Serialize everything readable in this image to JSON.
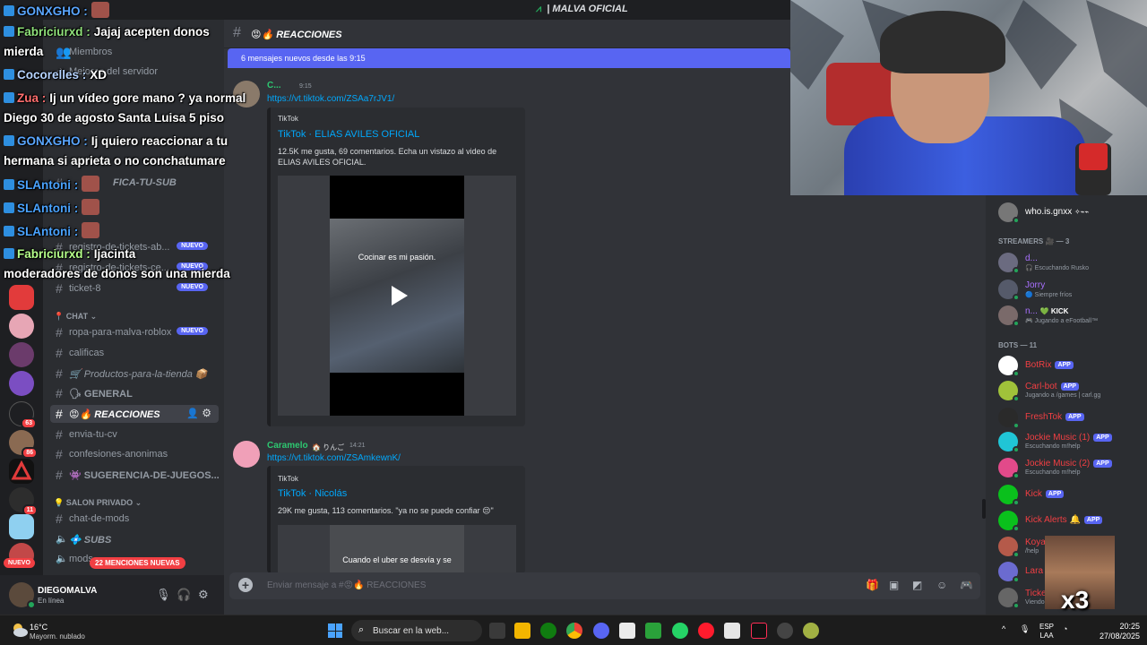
{
  "window": {
    "title": "| MALVA OFICIAL"
  },
  "sidebar": {
    "hidden_items": [
      "Miembros",
      "Mejoras del servidor"
    ],
    "partial_channel": "FICA-TU-SUB",
    "channels_tickets": [
      {
        "name": "registro-de-tickets-ab...",
        "badge": "NUEVO"
      },
      {
        "name": "registro-de-tickets-ce...",
        "badge": "NUEVO"
      },
      {
        "name": "ticket-8",
        "badge": "NUEVO"
      }
    ],
    "category_chat": "CHAT",
    "channels_chat": [
      {
        "name": "ropa-para-malva-roblox",
        "badge": "NUEVO"
      },
      {
        "name": "calificas",
        "badge": ""
      },
      {
        "name": "🛒 Productos-para-la-tienda 📦",
        "badge": ""
      },
      {
        "name": "🗣 GENERAL",
        "badge": ""
      },
      {
        "name": "😡🔥 REACCIONES",
        "badge": ""
      },
      {
        "name": "envia-tu-cv",
        "badge": ""
      },
      {
        "name": "confesiones-anonimas",
        "badge": ""
      },
      {
        "name": "👾 SUGERENCIA-DE-JUEGOS...",
        "badge": ""
      }
    ],
    "category_salon": "SALON PRIVADO",
    "channels_salon": [
      {
        "name": "chat-de-mods"
      },
      {
        "name": "💠 SUBS"
      },
      {
        "name": "mods"
      }
    ],
    "mentions_pill": "22 MENCIONES NUEVAS",
    "nuevo_pill": "NUEVO",
    "server_badges": [
      "63",
      "86",
      "11"
    ]
  },
  "user": {
    "name": "DIEGOMALVA",
    "status": "En línea"
  },
  "chat": {
    "channel_name": "😡🔥 REACCIONES",
    "new_messages_bar": "6 mensajes nuevos desde las 9:15",
    "messages": [
      {
        "author": "C...",
        "time": "9:15",
        "link": "https://vt.tiktok.com/ZSAa7rJV1/",
        "embed_provider": "TikTok",
        "embed_title": "TikTok · ELIAS AVILES OFICIAL",
        "embed_desc": "12.5K me gusta, 69 comentarios. Echa un vistazo al video de ELIAS AVILES OFICIAL.",
        "video_caption": "Cocinar es mi pasión."
      },
      {
        "author": "Caramelo",
        "author_tag": "🏠 りんご",
        "time": "14:21",
        "link": "https://vt.tiktok.com/ZSAmkewnK/",
        "embed_provider": "TikTok",
        "embed_title": "TikTok · Nicolás",
        "embed_desc": "29K me gusta, 113 comentarios. \"ya no se puede confiar 😒\"",
        "video_caption": "Cuando el uber se desvía y se"
      }
    ],
    "composer_placeholder": "Enviar mensaje a #😡🔥 REACCIONES"
  },
  "members": {
    "top_user": "who.is.gnxx",
    "top_user_tag": "✧⌁⌁",
    "streamers_header": "STREAMERS 🎥 — 3",
    "streamers": [
      {
        "name": "d...",
        "status": "🎧 Escuchando Rusko",
        "color": "#a970ff"
      },
      {
        "name": "Jorry",
        "status": "🔵 Siempre fríos",
        "color": "#a970ff"
      },
      {
        "name": "n...",
        "tag": "💚 KICK",
        "status": "🎮 Jugando a eFootball™",
        "color": "#a970ff"
      }
    ],
    "bots_header": "BOTS — 11",
    "bots": [
      {
        "name": "BotRix",
        "app": "APP",
        "status": "",
        "color": "#f23f43"
      },
      {
        "name": "Carl-bot",
        "app": "APP",
        "status": "Jugando a /games | carl.gg",
        "color": "#f23f43"
      },
      {
        "name": "FreshTok",
        "app": "APP",
        "status": "",
        "color": "#f23f43"
      },
      {
        "name": "Jockie Music (1)",
        "app": "APP",
        "status": "Escuchando m!help",
        "color": "#f23f43"
      },
      {
        "name": "Jockie Music (2)",
        "app": "APP",
        "status": "Escuchando m!help",
        "color": "#f23f43"
      },
      {
        "name": "Kick",
        "app": "APP",
        "status": "",
        "color": "#f23f43"
      },
      {
        "name": "Kick Alerts 🔔",
        "app": "APP",
        "status": "",
        "color": "#f23f43"
      },
      {
        "name": "Koya",
        "app": "",
        "status": "/help",
        "color": "#f23f43"
      },
      {
        "name": "Lara",
        "app": "",
        "status": "",
        "color": "#f23f43"
      },
      {
        "name": "Ticke",
        "app": "",
        "status": "Viendo",
        "color": "#f23f43"
      }
    ]
  },
  "overlay": [
    {
      "user": "GONXGHO :",
      "text": ""
    },
    {
      "user": "Fabriciurxd :",
      "text": "Jajaj acepten donos"
    },
    {
      "user": "",
      "text": "mierda"
    },
    {
      "user": "Cocorelles :",
      "text": "XD"
    },
    {
      "user": "Zua :",
      "text": "Ij un vídeo gore mano ? ya normal"
    },
    {
      "user": "",
      "text": "Diego 30 de agosto Santa Luisa 5 piso"
    },
    {
      "user": "GONXGHO :",
      "text": "Ij quiero reaccionar a tu"
    },
    {
      "user": "",
      "text": "hermana si aprieta o no conchatumare"
    },
    {
      "user": "SLAntoni :",
      "text": ""
    },
    {
      "user": "SLAntoni :",
      "text": ""
    },
    {
      "user": "SLAntoni :",
      "text": ""
    },
    {
      "user": "Fabriciurxd :",
      "text": "Ijacinta"
    },
    {
      "user": "",
      "text": "moderadores de donos son una mierda"
    }
  ],
  "meme_overlay": {
    "text": "x3"
  },
  "taskbar": {
    "temperature": "16°C",
    "condition": "Mayorm. nublado",
    "search_placeholder": "Buscar en la web...",
    "lang_top": "ESP",
    "lang_bottom": "LAA",
    "time": "20:25",
    "date": "27/08/2025"
  },
  "colors": {
    "accent": "#5865f2",
    "online": "#23a55a",
    "link": "#00a8fc",
    "danger": "#f23f43"
  }
}
